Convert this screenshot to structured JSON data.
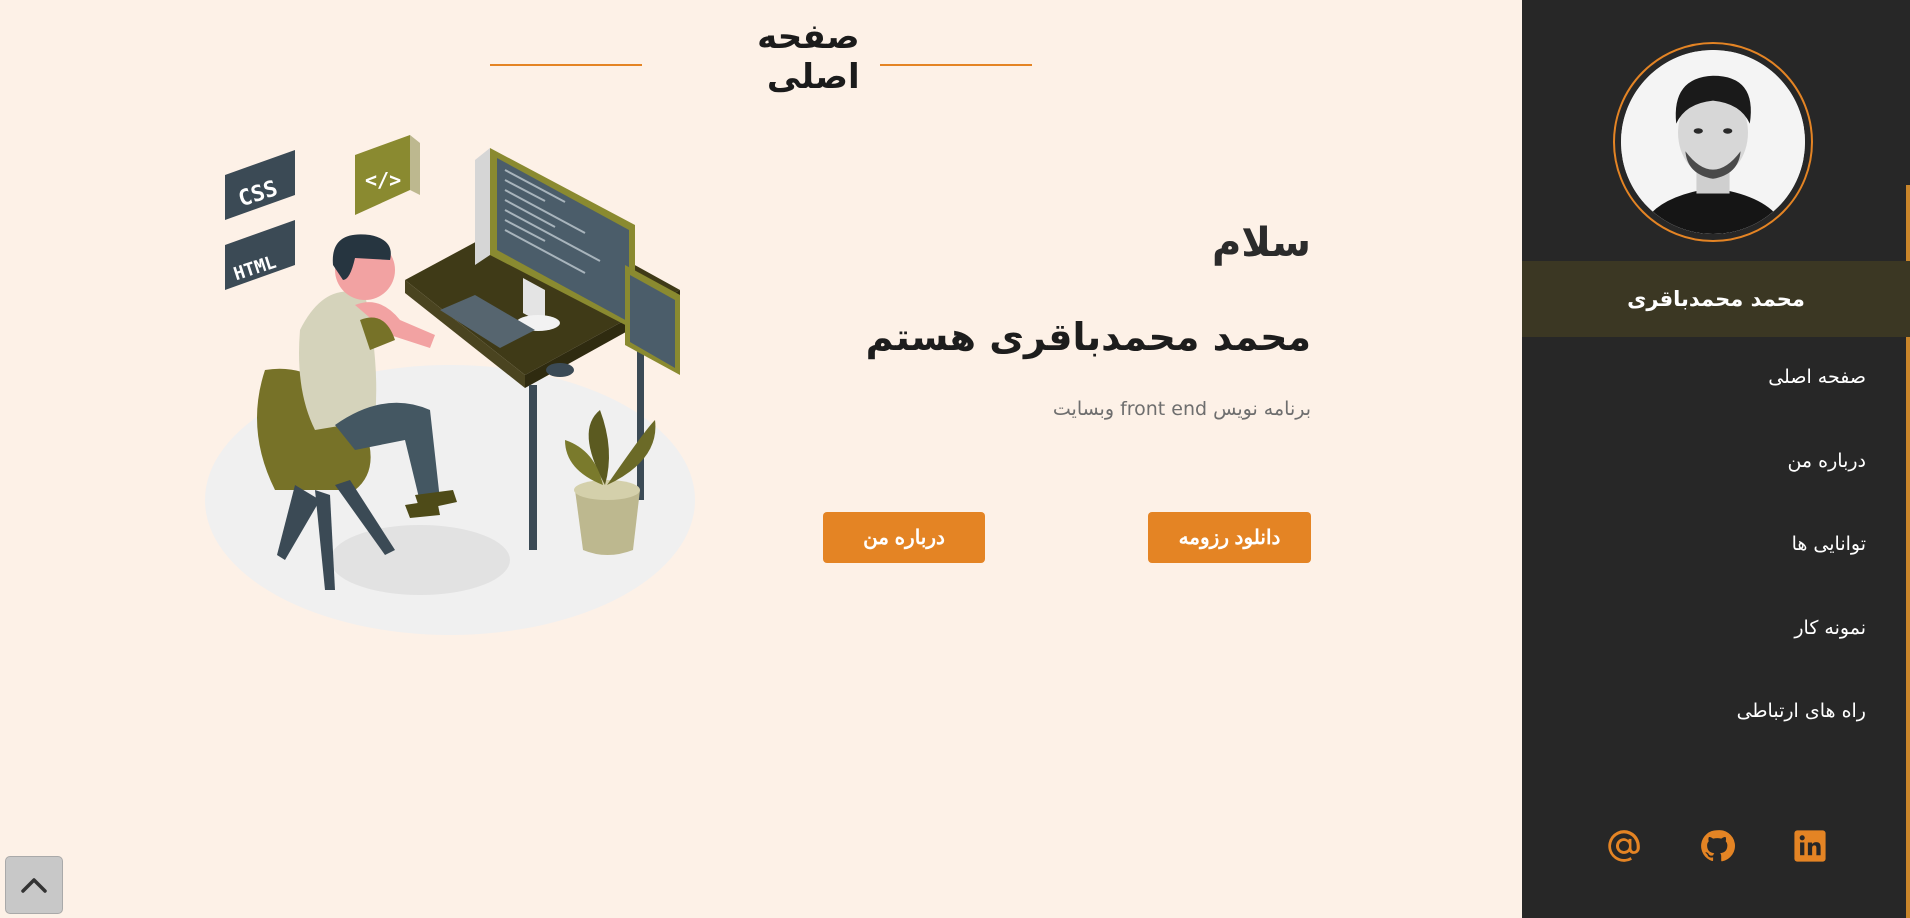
{
  "page_title": "صفحه اصلی",
  "hero": {
    "greeting": "سلام",
    "headline": "محمد محمدباقری هستم",
    "subtitle": "برنامه نویس front end وبسایت",
    "resume_button": "دانلود رزومه",
    "about_button": "درباره من"
  },
  "sidebar": {
    "name": "محمد محمدباقری",
    "nav": [
      {
        "label": "صفحه اصلی"
      },
      {
        "label": "درباره من"
      },
      {
        "label": "توانایی ها"
      },
      {
        "label": "نمونه کار"
      },
      {
        "label": "راه های ارتباطی"
      }
    ],
    "social": [
      {
        "icon": "email-at-icon"
      },
      {
        "icon": "github-icon"
      },
      {
        "icon": "linkedin-icon"
      }
    ]
  },
  "illustration": {
    "badges": [
      "CSS",
      "HTML",
      "</>"
    ]
  },
  "colors": {
    "accent": "#e48424",
    "sidebar_bg": "#272727",
    "name_band_bg": "#3b3723",
    "page_bg": "#fdf1e7"
  }
}
